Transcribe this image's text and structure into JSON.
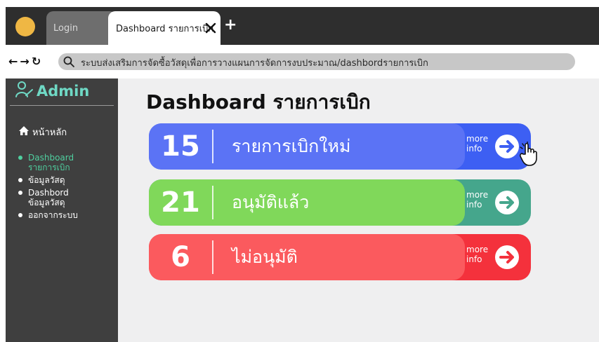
{
  "browser": {
    "tabs": [
      {
        "label": "Login"
      },
      {
        "label": "Dashboard รายการเบิก"
      }
    ],
    "new_tab_label": "+",
    "nav": {
      "back": "←",
      "forward": "→",
      "reload": "↻"
    },
    "address": "ระบบส่งเสริมการจัดซื้อวัสดุเพื่อการวางแผนการจัดการงบประมาณ/dashbordรายการเบิก"
  },
  "sidebar": {
    "brand": "Admin",
    "home_label": "หน้าหลัก",
    "items": [
      {
        "label_line1": "Dashboard",
        "label_line2": "รายการเบิก",
        "active": true
      },
      {
        "label_line1": "ข้อมูลวัสดุ",
        "label_line2": ""
      },
      {
        "label_line1": "Dashbord",
        "label_line2": "ข้อมูลวัสดุ"
      },
      {
        "label_line1": "ออกจากระบบ",
        "label_line2": ""
      }
    ]
  },
  "main": {
    "title": "Dashboard รายการเบิก",
    "cards": [
      {
        "count": "15",
        "label": "รายการเบิกใหม่",
        "more_line1": "more",
        "more_line2": "info",
        "color": "#5b73f5",
        "accent": "#3d5ff3"
      },
      {
        "count": "21",
        "label": "อนุมัติแล้ว",
        "more_line1": "more",
        "more_line2": "info",
        "color": "#80d85a",
        "accent": "#45a68c"
      },
      {
        "count": "6",
        "label": "ไม่อนุมัติ",
        "more_line1": "more",
        "more_line2": "info",
        "color": "#fb5a5e",
        "accent": "#f4313c"
      }
    ]
  },
  "colors": {
    "sidebar_bg": "#3f3f3f",
    "brand": "#6fd9c5",
    "active_item": "#4fcf9f",
    "main_bg": "#efeff0"
  },
  "icons": [
    "user-icon",
    "home-icon",
    "search-icon",
    "close-icon",
    "arrow-right-circle-icon",
    "hand-pointer-icon"
  ]
}
